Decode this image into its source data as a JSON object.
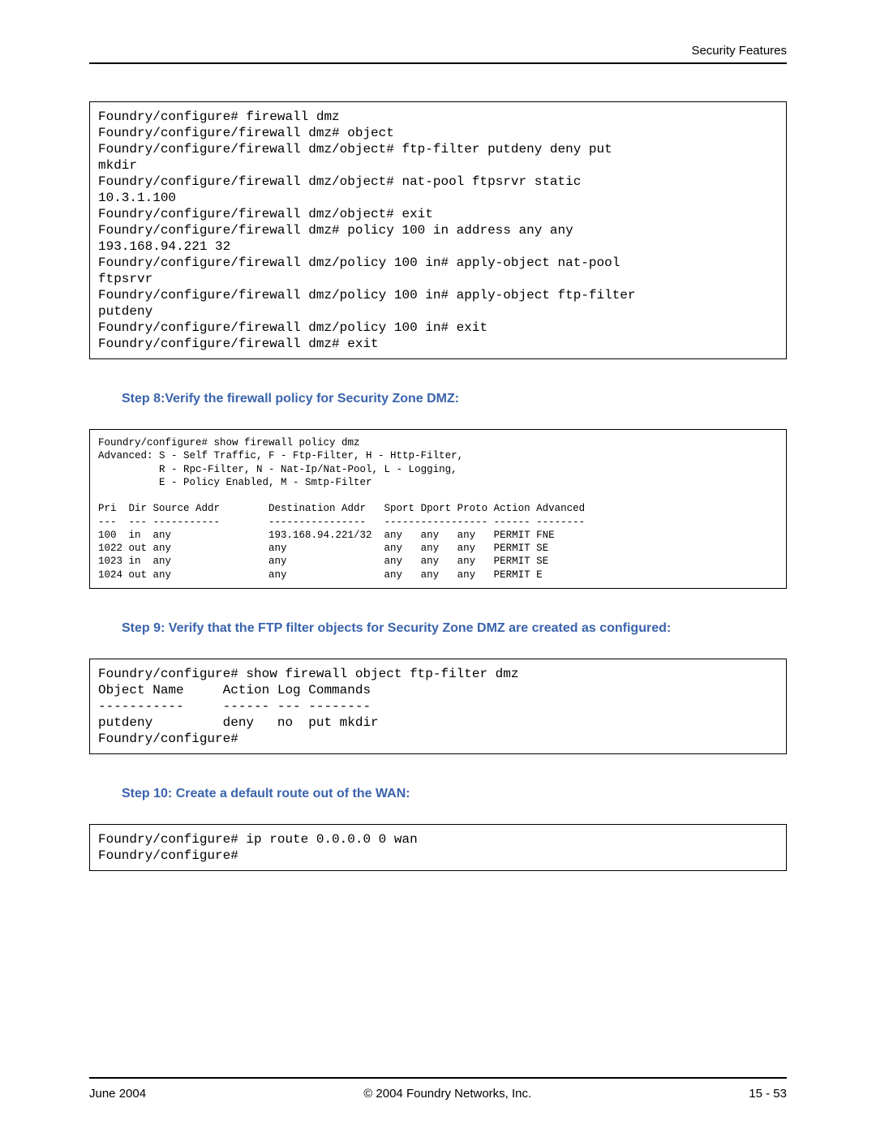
{
  "header": {
    "section_title": "Security Features"
  },
  "code1": "Foundry/configure# firewall dmz\nFoundry/configure/firewall dmz# object\nFoundry/configure/firewall dmz/object# ftp-filter putdeny deny put\nmkdir\nFoundry/configure/firewall dmz/object# nat-pool ftpsrvr static\n10.3.1.100\nFoundry/configure/firewall dmz/object# exit\nFoundry/configure/firewall dmz# policy 100 in address any any\n193.168.94.221 32\nFoundry/configure/firewall dmz/policy 100 in# apply-object nat-pool\nftpsrvr\nFoundry/configure/firewall dmz/policy 100 in# apply-object ftp-filter\nputdeny\nFoundry/configure/firewall dmz/policy 100 in# exit\nFoundry/configure/firewall dmz# exit",
  "step8": "Step 8:Verify the firewall policy for Security Zone DMZ:",
  "code2": "Foundry/configure# show firewall policy dmz\nAdvanced: S - Self Traffic, F - Ftp-Filter, H - Http-Filter,\n          R - Rpc-Filter, N - Nat-Ip/Nat-Pool, L - Logging,\n          E - Policy Enabled, M - Smtp-Filter\n\nPri  Dir Source Addr        Destination Addr   Sport Dport Proto Action Advanced\n---  --- -----------        ----------------   ----------------- ------ --------\n100  in  any                193.168.94.221/32  any   any   any   PERMIT FNE\n1022 out any                any                any   any   any   PERMIT SE\n1023 in  any                any                any   any   any   PERMIT SE\n1024 out any                any                any   any   any   PERMIT E",
  "step9": "Step 9: Verify that the FTP filter objects for Security Zone DMZ are created as configured:",
  "code3": "Foundry/configure# show firewall object ftp-filter dmz\nObject Name     Action Log Commands\n-----------     ------ --- --------\nputdeny         deny   no  put mkdir\nFoundry/configure#",
  "step10": "Step 10: Create a default route out of the WAN:",
  "code4": "Foundry/configure# ip route 0.0.0.0 0 wan\nFoundry/configure#",
  "footer": {
    "left": "June 2004",
    "center": "© 2004 Foundry Networks, Inc.",
    "right": "15 - 53"
  }
}
